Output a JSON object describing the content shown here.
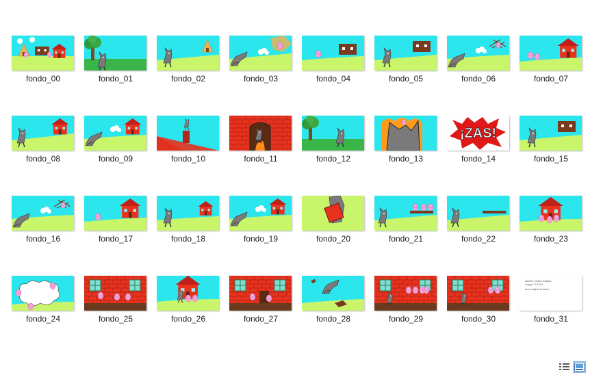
{
  "files": [
    {
      "name": "fondo_00",
      "scene": "houses"
    },
    {
      "name": "fondo_01",
      "scene": "tree-wolf"
    },
    {
      "name": "fondo_02",
      "scene": "wolf-straw"
    },
    {
      "name": "fondo_03",
      "scene": "wolf-blow-straw"
    },
    {
      "name": "fondo_04",
      "scene": "pig-wood"
    },
    {
      "name": "fondo_05",
      "scene": "wolf-wood"
    },
    {
      "name": "fondo_06",
      "scene": "wolf-blow-sticks"
    },
    {
      "name": "fondo_07",
      "scene": "pigs-brick"
    },
    {
      "name": "fondo_08",
      "scene": "wolf-brick"
    },
    {
      "name": "fondo_09",
      "scene": "wolf-blow-brick"
    },
    {
      "name": "fondo_10",
      "scene": "roof-chimney"
    },
    {
      "name": "fondo_11",
      "scene": "fireplace"
    },
    {
      "name": "fondo_12",
      "scene": "tree-wolf-run"
    },
    {
      "name": "fondo_13",
      "scene": "fire-wolf"
    },
    {
      "name": "fondo_14",
      "scene": "zas"
    },
    {
      "name": "fondo_15",
      "scene": "wolf-wood"
    },
    {
      "name": "fondo_16",
      "scene": "wolf-blow-sticks"
    },
    {
      "name": "fondo_17",
      "scene": "pig-brick"
    },
    {
      "name": "fondo_18",
      "scene": "wolf-brick-small"
    },
    {
      "name": "fondo_19",
      "scene": "wolf-blow-brick"
    },
    {
      "name": "fondo_20",
      "scene": "hand-brick"
    },
    {
      "name": "fondo_21",
      "scene": "wolf-pigs-plank"
    },
    {
      "name": "fondo_22",
      "scene": "wolf-plank"
    },
    {
      "name": "fondo_23",
      "scene": "pigs-brick-front"
    },
    {
      "name": "fondo_24",
      "scene": "cloud-pigs"
    },
    {
      "name": "fondo_25",
      "scene": "brick-wall"
    },
    {
      "name": "fondo_26",
      "scene": "wolf-brick-pigs"
    },
    {
      "name": "fondo_27",
      "scene": "brick-wall-door"
    },
    {
      "name": "fondo_28",
      "scene": "wolf-fly"
    },
    {
      "name": "fondo_29",
      "scene": "brick-wall-wolf"
    },
    {
      "name": "fondo_30",
      "scene": "brick-wall-wolf2"
    },
    {
      "name": "fondo_31",
      "scene": "credits"
    }
  ],
  "credits": {
    "line1": "Autores: Cristina Salgado",
    "line2": "Lengua: TUTULA",
    "line3": "Autor original: Antonina"
  },
  "view_buttons": [
    {
      "name": "details-view-button",
      "icon": "details-list-icon",
      "active": false
    },
    {
      "name": "large-icons-view-button",
      "icon": "large-thumbnails-icon",
      "active": true
    }
  ],
  "colors": {
    "sky": "#2ce6ee",
    "grass": "#c8f56a",
    "grass_dark": "#39b54a",
    "brick": "#e8321e",
    "wood": "#7a3a1e",
    "wolf": "#7a7a7a",
    "pig": "#f6a8de"
  }
}
